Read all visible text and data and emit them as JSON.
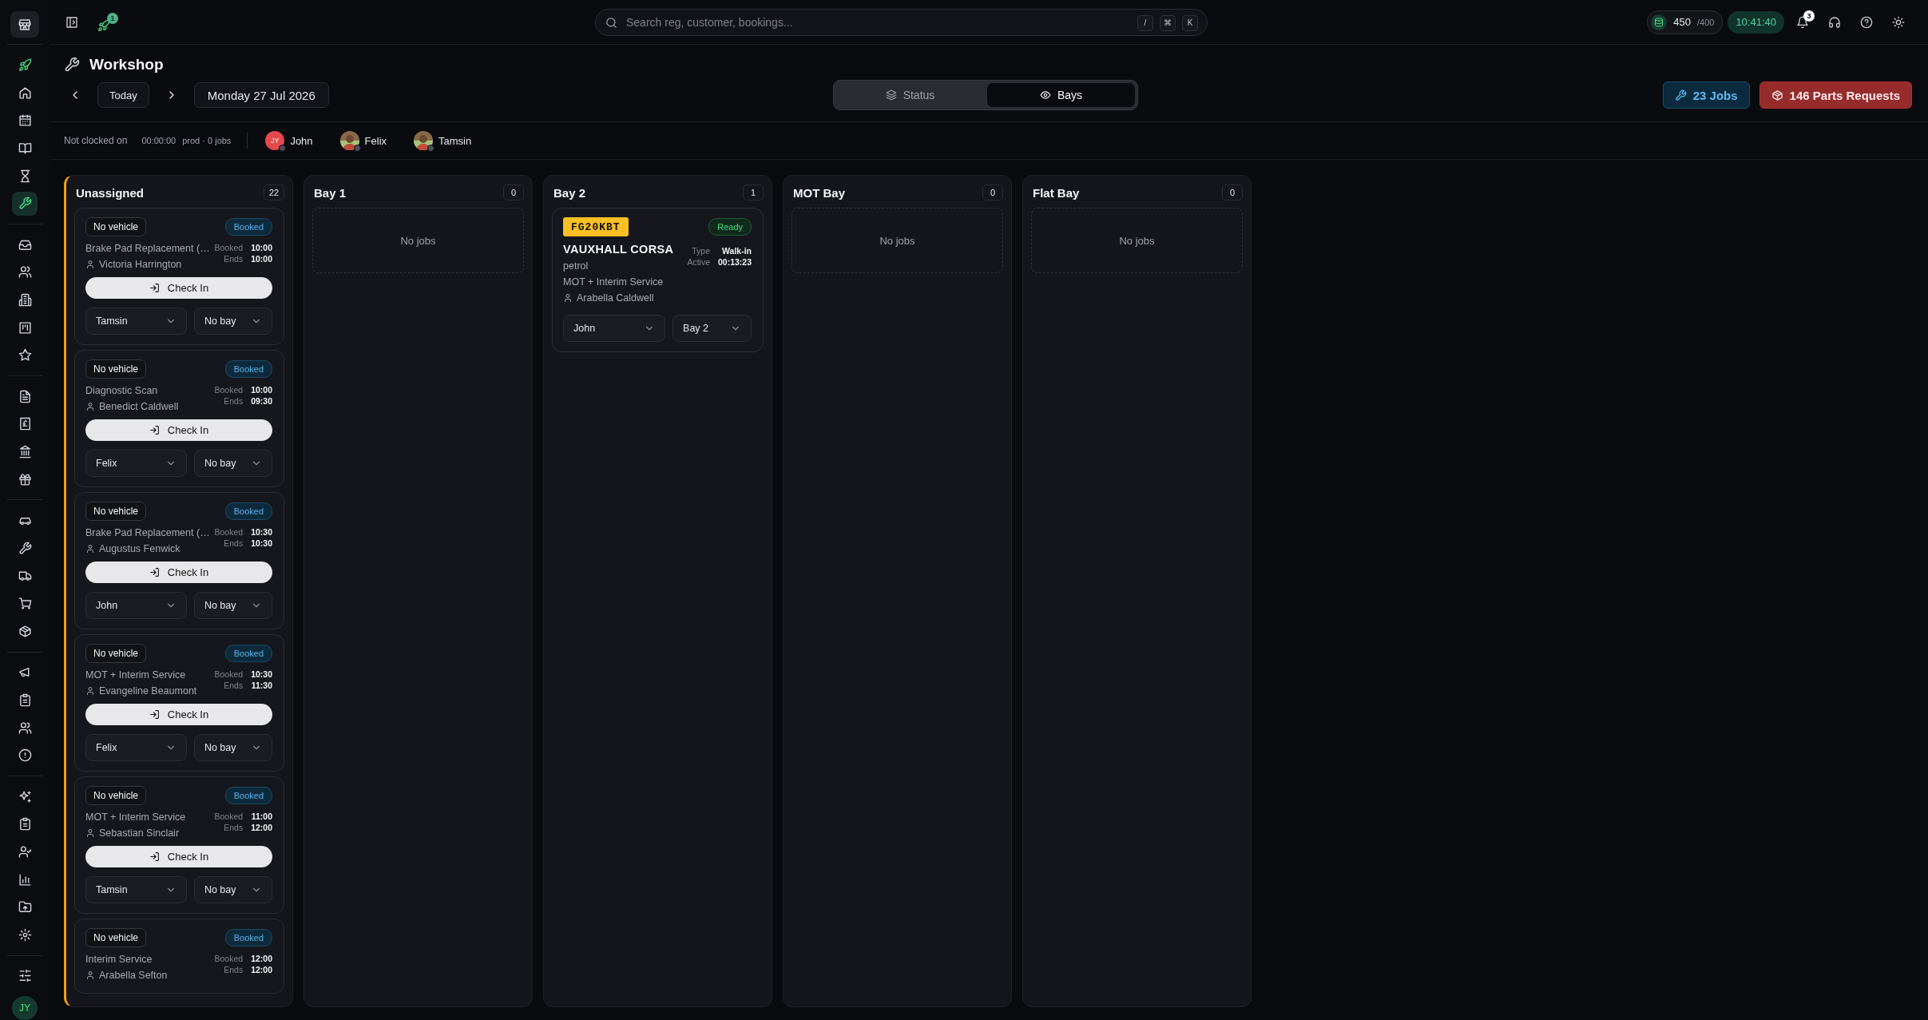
{
  "sidebar": {
    "groups": [
      [
        {
          "selected": false
        },
        {
          "selected": false
        },
        {
          "selected": false
        },
        {
          "selected": false
        },
        {
          "selected": false
        },
        {
          "selected": true
        }
      ],
      [
        {
          "selected": false
        },
        {
          "selected": false
        },
        {
          "selected": false
        },
        {
          "selected": false
        },
        {
          "selected": false
        }
      ],
      [
        {
          "selected": false
        },
        {
          "selected": false
        },
        {
          "selected": false
        },
        {
          "selected": false
        }
      ],
      [
        {
          "selected": false
        },
        {
          "selected": false
        },
        {
          "selected": false
        },
        {
          "selected": false
        },
        {
          "selected": false
        }
      ],
      [
        {
          "selected": false
        },
        {
          "selected": false
        },
        {
          "selected": false
        },
        {
          "selected": false
        }
      ],
      [
        {
          "selected": false
        },
        {
          "selected": false
        },
        {
          "selected": false
        },
        {
          "selected": false
        },
        {
          "selected": false
        },
        {
          "selected": false
        }
      ],
      [
        {
          "selected": false
        }
      ]
    ],
    "avatar": "JY"
  },
  "topbar": {
    "launch_badge": "1",
    "search": {
      "placeholder": "Search reg, customer, bookings..."
    },
    "shortcut_keys": [
      "/",
      "⌘",
      "K"
    ],
    "credits": {
      "value": "450",
      "limit": "/400"
    },
    "clock": "10:41:40",
    "notifications_badge": "3"
  },
  "page": {
    "title": "Workshop",
    "today": "Today",
    "date": "Monday 27 Jul 2026",
    "views": [
      {
        "label": "Status",
        "selected": false
      },
      {
        "label": "Bays",
        "selected": true
      }
    ],
    "jobs_button": "23 Jobs",
    "parts_button": "146 Parts Requests"
  },
  "clock_bar": {
    "status": "Not clocked on",
    "timer": "00:00:00",
    "summary": "prod · 0 jobs",
    "staff": [
      {
        "name": "John",
        "kind": "initials",
        "initials": "JY"
      },
      {
        "name": "Felix"
      },
      {
        "name": "Tamsin"
      }
    ]
  },
  "columns": [
    {
      "title": "Unassigned",
      "count": "22",
      "accent": true,
      "jobs": [
        {
          "vehicle": {
            "kind": "none",
            "text": "No vehicle"
          },
          "status": {
            "kind": "booked",
            "text": "Booked"
          },
          "service": "Brake Pad Replacement (…",
          "customer": "Victoria Harrington",
          "meta": [
            {
              "label": "Booked",
              "value": "10:00"
            },
            {
              "label": "Ends",
              "value": "10:00"
            }
          ],
          "action": "Check In",
          "technician": "Tamsin",
          "bay": "No bay"
        },
        {
          "vehicle": {
            "kind": "none",
            "text": "No vehicle"
          },
          "status": {
            "kind": "booked",
            "text": "Booked"
          },
          "service": "Diagnostic Scan",
          "customer": "Benedict Caldwell",
          "meta": [
            {
              "label": "Booked",
              "value": "10:00"
            },
            {
              "label": "Ends",
              "value": "09:30"
            }
          ],
          "action": "Check In",
          "technician": "Felix",
          "bay": "No bay"
        },
        {
          "vehicle": {
            "kind": "none",
            "text": "No vehicle"
          },
          "status": {
            "kind": "booked",
            "text": "Booked"
          },
          "service": "Brake Pad Replacement (…",
          "customer": "Augustus Fenwick",
          "meta": [
            {
              "label": "Booked",
              "value": "10:30"
            },
            {
              "label": "Ends",
              "value": "10:30"
            }
          ],
          "action": "Check In",
          "technician": "John",
          "bay": "No bay"
        },
        {
          "vehicle": {
            "kind": "none",
            "text": "No vehicle"
          },
          "status": {
            "kind": "booked",
            "text": "Booked"
          },
          "service": "MOT + Interim Service",
          "customer": "Evangeline Beaumont",
          "meta": [
            {
              "label": "Booked",
              "value": "10:30"
            },
            {
              "label": "Ends",
              "value": "11:30"
            }
          ],
          "action": "Check In",
          "technician": "Felix",
          "bay": "No bay"
        },
        {
          "vehicle": {
            "kind": "none",
            "text": "No vehicle"
          },
          "status": {
            "kind": "booked",
            "text": "Booked"
          },
          "service": "MOT + Interim Service",
          "customer": "Sebastian Sinclair",
          "meta": [
            {
              "label": "Booked",
              "value": "11:00"
            },
            {
              "label": "Ends",
              "value": "12:00"
            }
          ],
          "action": "Check In",
          "technician": "Tamsin",
          "bay": "No bay"
        },
        {
          "vehicle": {
            "kind": "none",
            "text": "No vehicle"
          },
          "status": {
            "kind": "booked",
            "text": "Booked"
          },
          "service": "Interim Service",
          "customer": "Arabella Sefton",
          "meta": [
            {
              "label": "Booked",
              "value": "12:00"
            },
            {
              "label": "Ends",
              "value": "12:00"
            }
          ]
        }
      ]
    },
    {
      "title": "Bay 1",
      "count": "0",
      "accent": false,
      "empty_text": "No jobs"
    },
    {
      "title": "Bay 2",
      "count": "1",
      "accent": false,
      "jobs": [
        {
          "vehicle": {
            "kind": "plate",
            "text": "FG20KBT"
          },
          "status": {
            "kind": "ready",
            "text": "Ready"
          },
          "model": "VAUXHALL CORSA",
          "fuel": "petrol",
          "service": "MOT + Interim Service",
          "customer": "Arabella Caldwell",
          "meta": [
            {
              "label": "Type",
              "value": "Walk-in"
            },
            {
              "label": "Active",
              "value": "00:13:23"
            }
          ],
          "technician": "John",
          "bay": "Bay 2"
        }
      ]
    },
    {
      "title": "MOT Bay",
      "count": "0",
      "accent": false,
      "empty_text": "No jobs"
    },
    {
      "title": "Flat Bay",
      "count": "0",
      "accent": false,
      "empty_text": "No jobs"
    }
  ]
}
